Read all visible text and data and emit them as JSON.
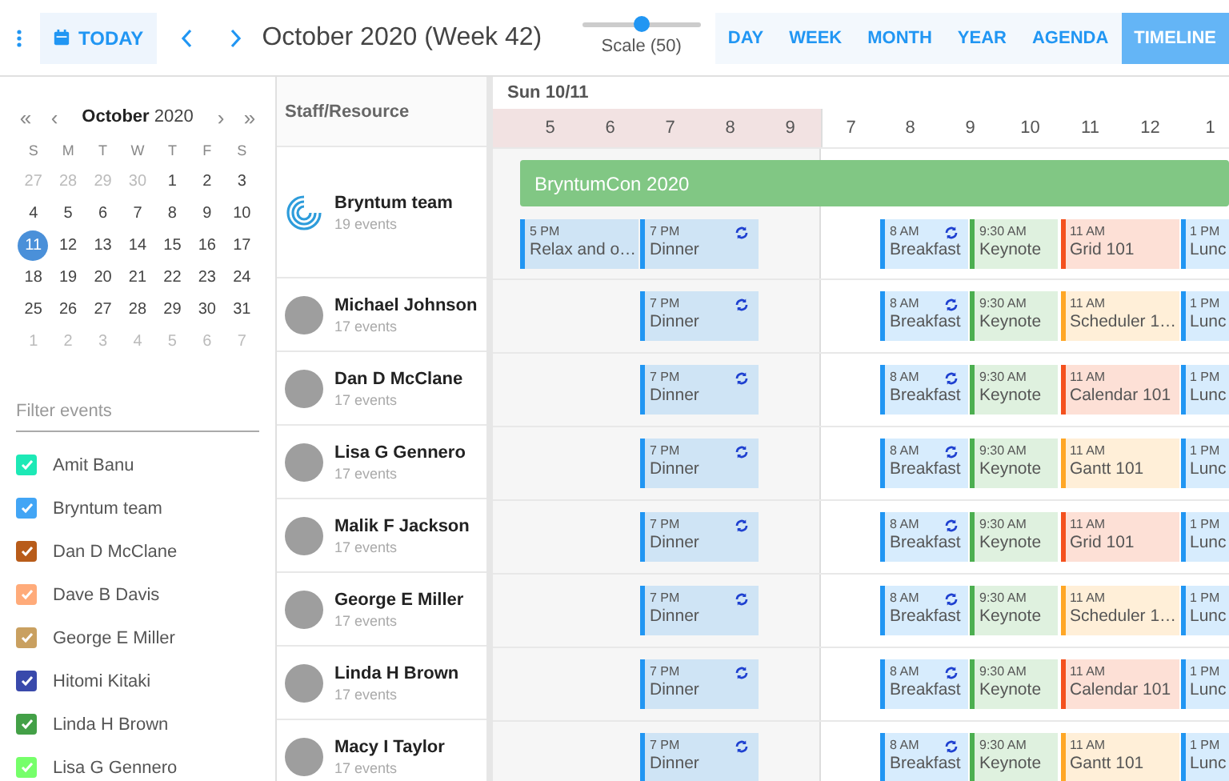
{
  "toolbar": {
    "today": "TODAY",
    "title": "October 2020 (Week 42)",
    "scale": {
      "label": "Scale (50)",
      "level": 0.5
    },
    "views": [
      {
        "label": "DAY",
        "selected": false
      },
      {
        "label": "WEEK",
        "selected": false
      },
      {
        "label": "MONTH",
        "selected": false
      },
      {
        "label": "YEAR",
        "selected": false
      },
      {
        "label": "AGENDA",
        "selected": false
      },
      {
        "label": "TIMELINE",
        "selected": true
      }
    ]
  },
  "sidebar": {
    "calendar": {
      "prev_year": "«",
      "prev_month": "‹",
      "month": "October",
      "year": "2020",
      "next_month": "›",
      "next_year": "»",
      "weekdays": [
        "S",
        "M",
        "T",
        "W",
        "T",
        "F",
        "S"
      ],
      "weeks": [
        [
          {
            "day": "27",
            "muted": true,
            "selected": false
          },
          {
            "day": "28",
            "muted": true,
            "selected": false
          },
          {
            "day": "29",
            "muted": true,
            "selected": false
          },
          {
            "day": "30",
            "muted": true,
            "selected": false
          },
          {
            "day": "1",
            "muted": false,
            "selected": false
          },
          {
            "day": "2",
            "muted": false,
            "selected": false
          },
          {
            "day": "3",
            "muted": false,
            "selected": false
          }
        ],
        [
          {
            "day": "4",
            "muted": false,
            "selected": false
          },
          {
            "day": "5",
            "muted": false,
            "selected": false
          },
          {
            "day": "6",
            "muted": false,
            "selected": false
          },
          {
            "day": "7",
            "muted": false,
            "selected": false
          },
          {
            "day": "8",
            "muted": false,
            "selected": false
          },
          {
            "day": "9",
            "muted": false,
            "selected": false
          },
          {
            "day": "10",
            "muted": false,
            "selected": false
          }
        ],
        [
          {
            "day": "11",
            "muted": false,
            "selected": true
          },
          {
            "day": "12",
            "muted": false,
            "selected": false
          },
          {
            "day": "13",
            "muted": false,
            "selected": false
          },
          {
            "day": "14",
            "muted": false,
            "selected": false
          },
          {
            "day": "15",
            "muted": false,
            "selected": false
          },
          {
            "day": "16",
            "muted": false,
            "selected": false
          },
          {
            "day": "17",
            "muted": false,
            "selected": false
          }
        ],
        [
          {
            "day": "18",
            "muted": false,
            "selected": false
          },
          {
            "day": "19",
            "muted": false,
            "selected": false
          },
          {
            "day": "20",
            "muted": false,
            "selected": false
          },
          {
            "day": "21",
            "muted": false,
            "selected": false
          },
          {
            "day": "22",
            "muted": false,
            "selected": false
          },
          {
            "day": "23",
            "muted": false,
            "selected": false
          },
          {
            "day": "24",
            "muted": false,
            "selected": false
          }
        ],
        [
          {
            "day": "25",
            "muted": false,
            "selected": false
          },
          {
            "day": "26",
            "muted": false,
            "selected": false
          },
          {
            "day": "27",
            "muted": false,
            "selected": false
          },
          {
            "day": "28",
            "muted": false,
            "selected": false
          },
          {
            "day": "29",
            "muted": false,
            "selected": false
          },
          {
            "day": "30",
            "muted": false,
            "selected": false
          },
          {
            "day": "31",
            "muted": false,
            "selected": false
          }
        ],
        [
          {
            "day": "1",
            "muted": true,
            "selected": false
          },
          {
            "day": "2",
            "muted": true,
            "selected": false
          },
          {
            "day": "3",
            "muted": true,
            "selected": false
          },
          {
            "day": "4",
            "muted": true,
            "selected": false
          },
          {
            "day": "5",
            "muted": true,
            "selected": false
          },
          {
            "day": "6",
            "muted": true,
            "selected": false
          },
          {
            "day": "7",
            "muted": true,
            "selected": false
          }
        ]
      ]
    },
    "filter": {
      "placeholder": "Filter events"
    },
    "resources": [
      {
        "name": "Amit Banu",
        "checked": true,
        "color": "#1de9b6"
      },
      {
        "name": "Bryntum team",
        "checked": true,
        "color": "#42a5f5"
      },
      {
        "name": "Dan D McClane",
        "checked": true,
        "color": "#b85c1a"
      },
      {
        "name": "Dave B Davis",
        "checked": true,
        "color": "#ffab7a"
      },
      {
        "name": "George E Miller",
        "checked": true,
        "color": "#c9a060"
      },
      {
        "name": "Hitomi Kitaki",
        "checked": true,
        "color": "#3949ab"
      },
      {
        "name": "Linda H Brown",
        "checked": true,
        "color": "#43a047"
      },
      {
        "name": "Lisa G Gennero",
        "checked": true,
        "color": "#76ff6a"
      }
    ]
  },
  "timeline": {
    "column_header": "Staff/Resource",
    "date": "Sun 10/11",
    "hours": [
      {
        "label": "5",
        "shaded": true
      },
      {
        "label": "6",
        "shaded": true
      },
      {
        "label": "7",
        "shaded": true
      },
      {
        "label": "8",
        "shaded": true
      },
      {
        "label": "9",
        "shaded": true
      },
      {
        "label": "7",
        "shaded": false
      },
      {
        "label": "8",
        "shaded": false
      },
      {
        "label": "9",
        "shaded": false
      },
      {
        "label": "10",
        "shaded": false
      },
      {
        "label": "11",
        "shaded": false
      },
      {
        "label": "12",
        "shaded": false
      },
      {
        "label": "1",
        "shaded": false
      }
    ],
    "rows": [
      {
        "kind": "team",
        "name": "Bryntum team",
        "count": "19 events",
        "allday": {
          "title": "BryntumCon 2020",
          "color": "#81c784"
        },
        "events": [
          {
            "time": "5 PM",
            "title": "Relax and o…",
            "color": "#2196f3",
            "recurring": false
          },
          {
            "time": "7 PM",
            "title": "Dinner",
            "color": "#2196f3",
            "recurring": true
          },
          {
            "time": "8 AM",
            "title": "Breakfast",
            "color": "#2196f3",
            "recurring": true
          },
          {
            "time": "9:30 AM",
            "title": "Keynote",
            "color": "#4caf50",
            "recurring": false
          },
          {
            "time": "11 AM",
            "title": "Grid 101",
            "color": "#f4511e",
            "recurring": false
          },
          {
            "time": "1 PM",
            "title": "Lunc",
            "color": "#2196f3",
            "recurring": false
          }
        ]
      },
      {
        "kind": "person",
        "name": "Michael Johnson",
        "count": "17 events",
        "events": [
          {
            "time": "7 PM",
            "title": "Dinner",
            "color": "#2196f3",
            "recurring": true
          },
          {
            "time": "8 AM",
            "title": "Breakfast",
            "color": "#2196f3",
            "recurring": true
          },
          {
            "time": "9:30 AM",
            "title": "Keynote",
            "color": "#4caf50",
            "recurring": false
          },
          {
            "time": "11 AM",
            "title": "Scheduler 1…",
            "color": "#ffa726",
            "recurring": false
          },
          {
            "time": "1 PM",
            "title": "Lunc",
            "color": "#2196f3",
            "recurring": false
          }
        ]
      },
      {
        "kind": "person",
        "name": "Dan D McClane",
        "count": "17 events",
        "events": [
          {
            "time": "7 PM",
            "title": "Dinner",
            "color": "#2196f3",
            "recurring": true
          },
          {
            "time": "8 AM",
            "title": "Breakfast",
            "color": "#2196f3",
            "recurring": true
          },
          {
            "time": "9:30 AM",
            "title": "Keynote",
            "color": "#4caf50",
            "recurring": false
          },
          {
            "time": "11 AM",
            "title": "Calendar 101",
            "color": "#f4511e",
            "recurring": false
          },
          {
            "time": "1 PM",
            "title": "Lunc",
            "color": "#2196f3",
            "recurring": false
          }
        ]
      },
      {
        "kind": "person",
        "name": "Lisa G Gennero",
        "count": "17 events",
        "events": [
          {
            "time": "7 PM",
            "title": "Dinner",
            "color": "#2196f3",
            "recurring": true
          },
          {
            "time": "8 AM",
            "title": "Breakfast",
            "color": "#2196f3",
            "recurring": true
          },
          {
            "time": "9:30 AM",
            "title": "Keynote",
            "color": "#4caf50",
            "recurring": false
          },
          {
            "time": "11 AM",
            "title": "Gantt 101",
            "color": "#ffa726",
            "recurring": false
          },
          {
            "time": "1 PM",
            "title": "Lunc",
            "color": "#2196f3",
            "recurring": false
          }
        ]
      },
      {
        "kind": "person",
        "name": "Malik F Jackson",
        "count": "17 events",
        "events": [
          {
            "time": "7 PM",
            "title": "Dinner",
            "color": "#2196f3",
            "recurring": true
          },
          {
            "time": "8 AM",
            "title": "Breakfast",
            "color": "#2196f3",
            "recurring": true
          },
          {
            "time": "9:30 AM",
            "title": "Keynote",
            "color": "#4caf50",
            "recurring": false
          },
          {
            "time": "11 AM",
            "title": "Grid 101",
            "color": "#f4511e",
            "recurring": false
          },
          {
            "time": "1 PM",
            "title": "Lunc",
            "color": "#2196f3",
            "recurring": false
          }
        ]
      },
      {
        "kind": "person",
        "name": "George E Miller",
        "count": "17 events",
        "events": [
          {
            "time": "7 PM",
            "title": "Dinner",
            "color": "#2196f3",
            "recurring": true
          },
          {
            "time": "8 AM",
            "title": "Breakfast",
            "color": "#2196f3",
            "recurring": true
          },
          {
            "time": "9:30 AM",
            "title": "Keynote",
            "color": "#4caf50",
            "recurring": false
          },
          {
            "time": "11 AM",
            "title": "Scheduler 1…",
            "color": "#ffa726",
            "recurring": false
          },
          {
            "time": "1 PM",
            "title": "Lunc",
            "color": "#2196f3",
            "recurring": false
          }
        ]
      },
      {
        "kind": "person",
        "name": "Linda H Brown",
        "count": "17 events",
        "events": [
          {
            "time": "7 PM",
            "title": "Dinner",
            "color": "#2196f3",
            "recurring": true
          },
          {
            "time": "8 AM",
            "title": "Breakfast",
            "color": "#2196f3",
            "recurring": true
          },
          {
            "time": "9:30 AM",
            "title": "Keynote",
            "color": "#4caf50",
            "recurring": false
          },
          {
            "time": "11 AM",
            "title": "Calendar 101",
            "color": "#f4511e",
            "recurring": false
          },
          {
            "time": "1 PM",
            "title": "Lunc",
            "color": "#2196f3",
            "recurring": false
          }
        ]
      },
      {
        "kind": "person",
        "name": "Macy I Taylor",
        "count": "17 events",
        "events": [
          {
            "time": "7 PM",
            "title": "Dinner",
            "color": "#2196f3",
            "recurring": true
          },
          {
            "time": "8 AM",
            "title": "Breakfast",
            "color": "#2196f3",
            "recurring": true
          },
          {
            "time": "9:30 AM",
            "title": "Keynote",
            "color": "#4caf50",
            "recurring": false
          },
          {
            "time": "11 AM",
            "title": "Gantt 101",
            "color": "#ffa726",
            "recurring": false
          },
          {
            "time": "1 PM",
            "title": "Lunc",
            "color": "#2196f3",
            "recurring": false
          }
        ]
      }
    ]
  }
}
